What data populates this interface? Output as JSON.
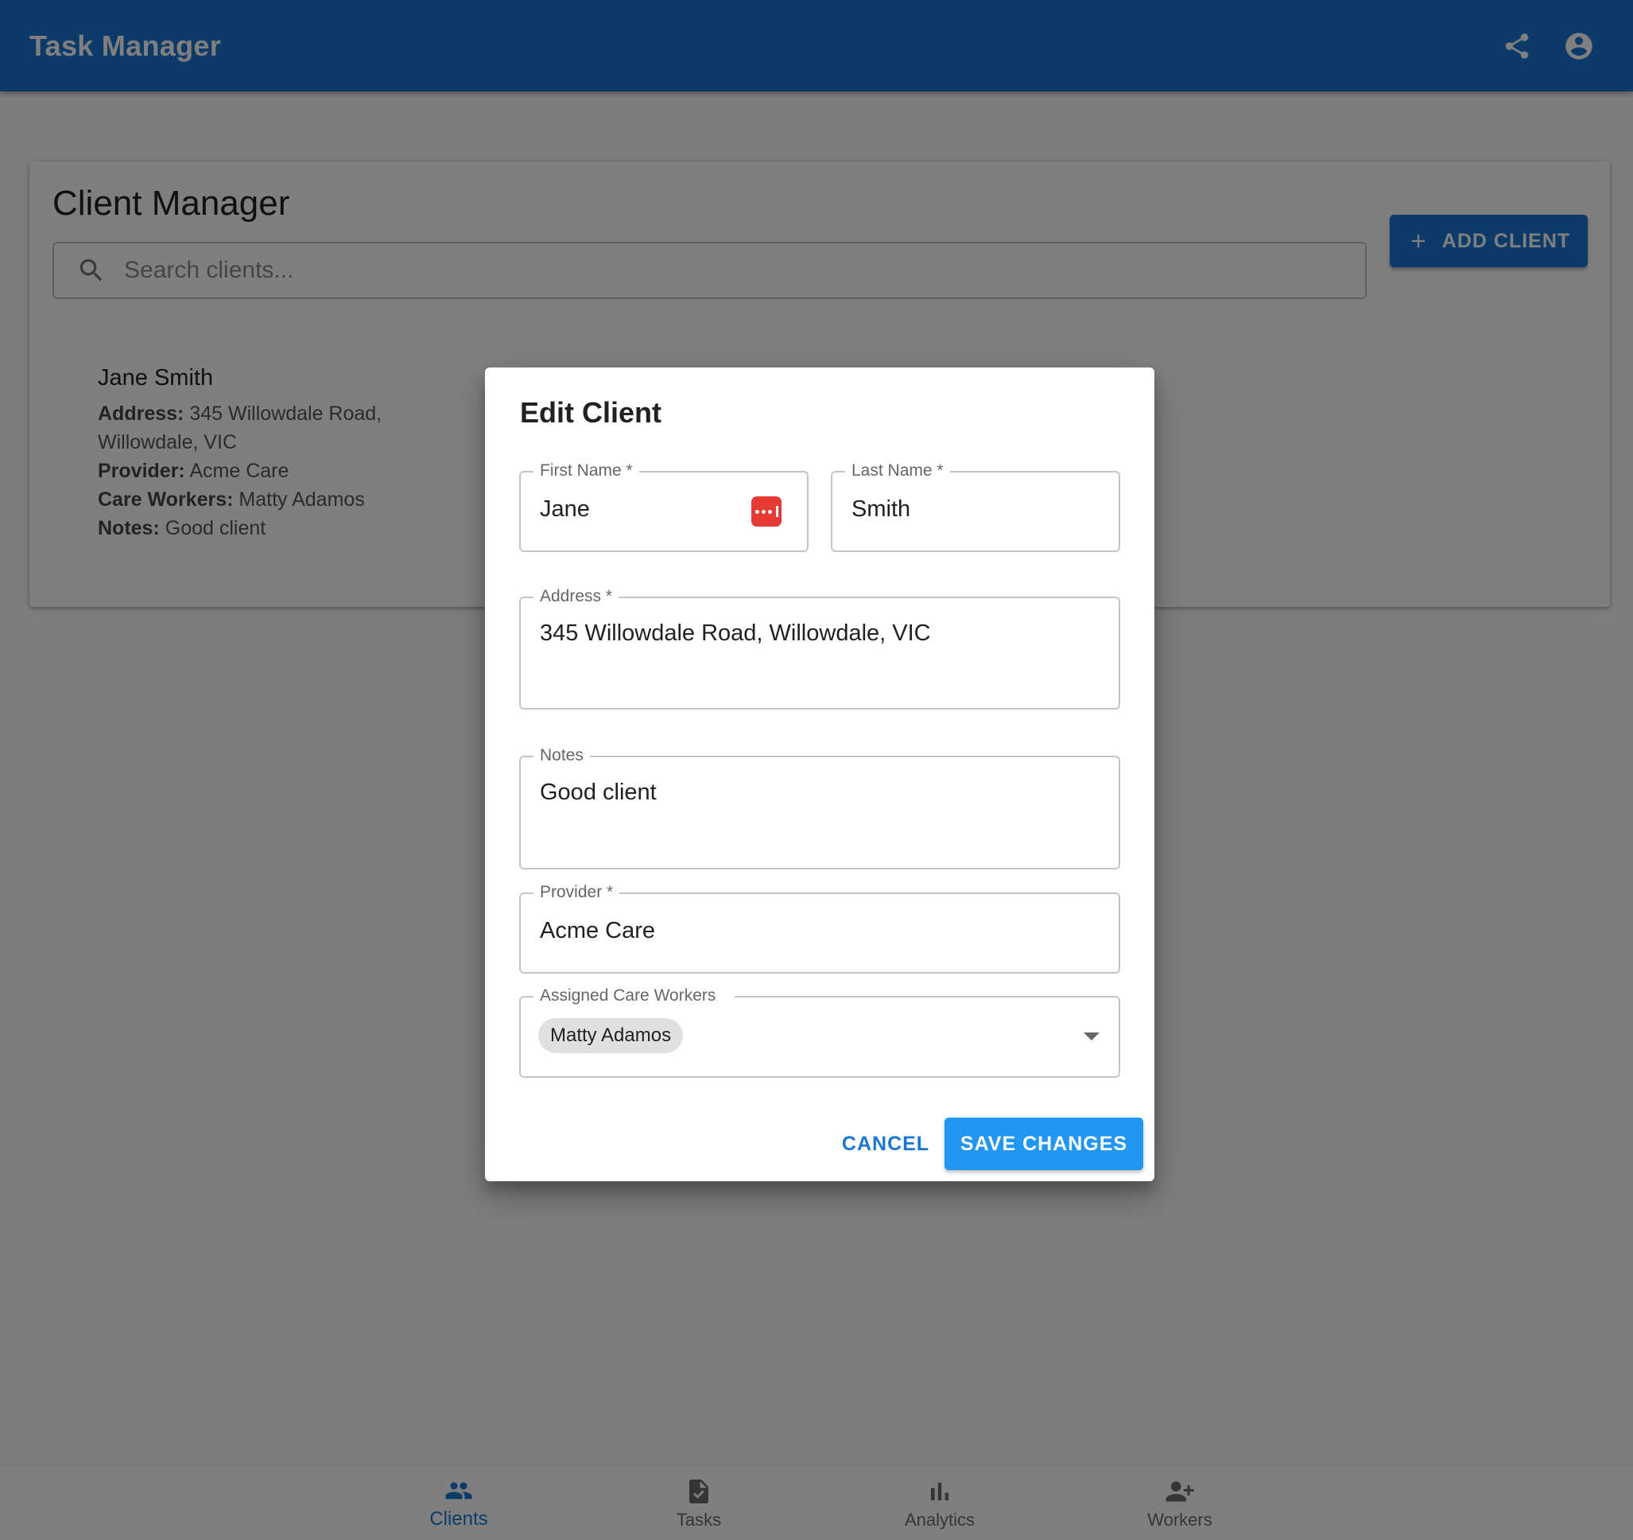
{
  "appbar": {
    "title": "Task Manager",
    "share_icon": "share-icon",
    "account_icon": "account-circle-icon"
  },
  "client_manager": {
    "title": "Client Manager",
    "search": {
      "placeholder": "Search clients..."
    },
    "add_button_label": "ADD CLIENT",
    "client": {
      "name": "Jane Smith",
      "address_label": "Address:",
      "address_line1": "345 Willowdale Road,",
      "address_line2": "Willowdale, VIC",
      "provider_label": "Provider:",
      "provider": "Acme Care",
      "care_workers_label": "Care Workers:",
      "care_workers": "Matty Adamos",
      "notes_label": "Notes:",
      "notes": "Good client"
    }
  },
  "dialog": {
    "title": "Edit Client",
    "first_name": {
      "label": "First Name *",
      "value": "Jane"
    },
    "last_name": {
      "label": "Last Name *",
      "value": "Smith"
    },
    "address": {
      "label": "Address *",
      "value": "345 Willowdale Road, Willowdale, VIC"
    },
    "notes": {
      "label": "Notes",
      "value": "Good client"
    },
    "provider": {
      "label": "Provider *",
      "value": "Acme Care"
    },
    "care_workers": {
      "label": "Assigned Care Workers",
      "chips": [
        "Matty Adamos"
      ]
    },
    "cancel_label": "CANCEL",
    "save_label": "SAVE CHANGES"
  },
  "bottom_nav": {
    "items": [
      {
        "label": "Clients",
        "icon": "people-icon",
        "active": true
      },
      {
        "label": "Tasks",
        "icon": "task-document-icon",
        "active": false
      },
      {
        "label": "Analytics",
        "icon": "bar-chart-icon",
        "active": false
      },
      {
        "label": "Workers",
        "icon": "person-add-icon",
        "active": false
      }
    ]
  },
  "colors": {
    "primary": "#1976d2",
    "save_button": "#2196f3",
    "password_manager_icon": "#e53935"
  }
}
